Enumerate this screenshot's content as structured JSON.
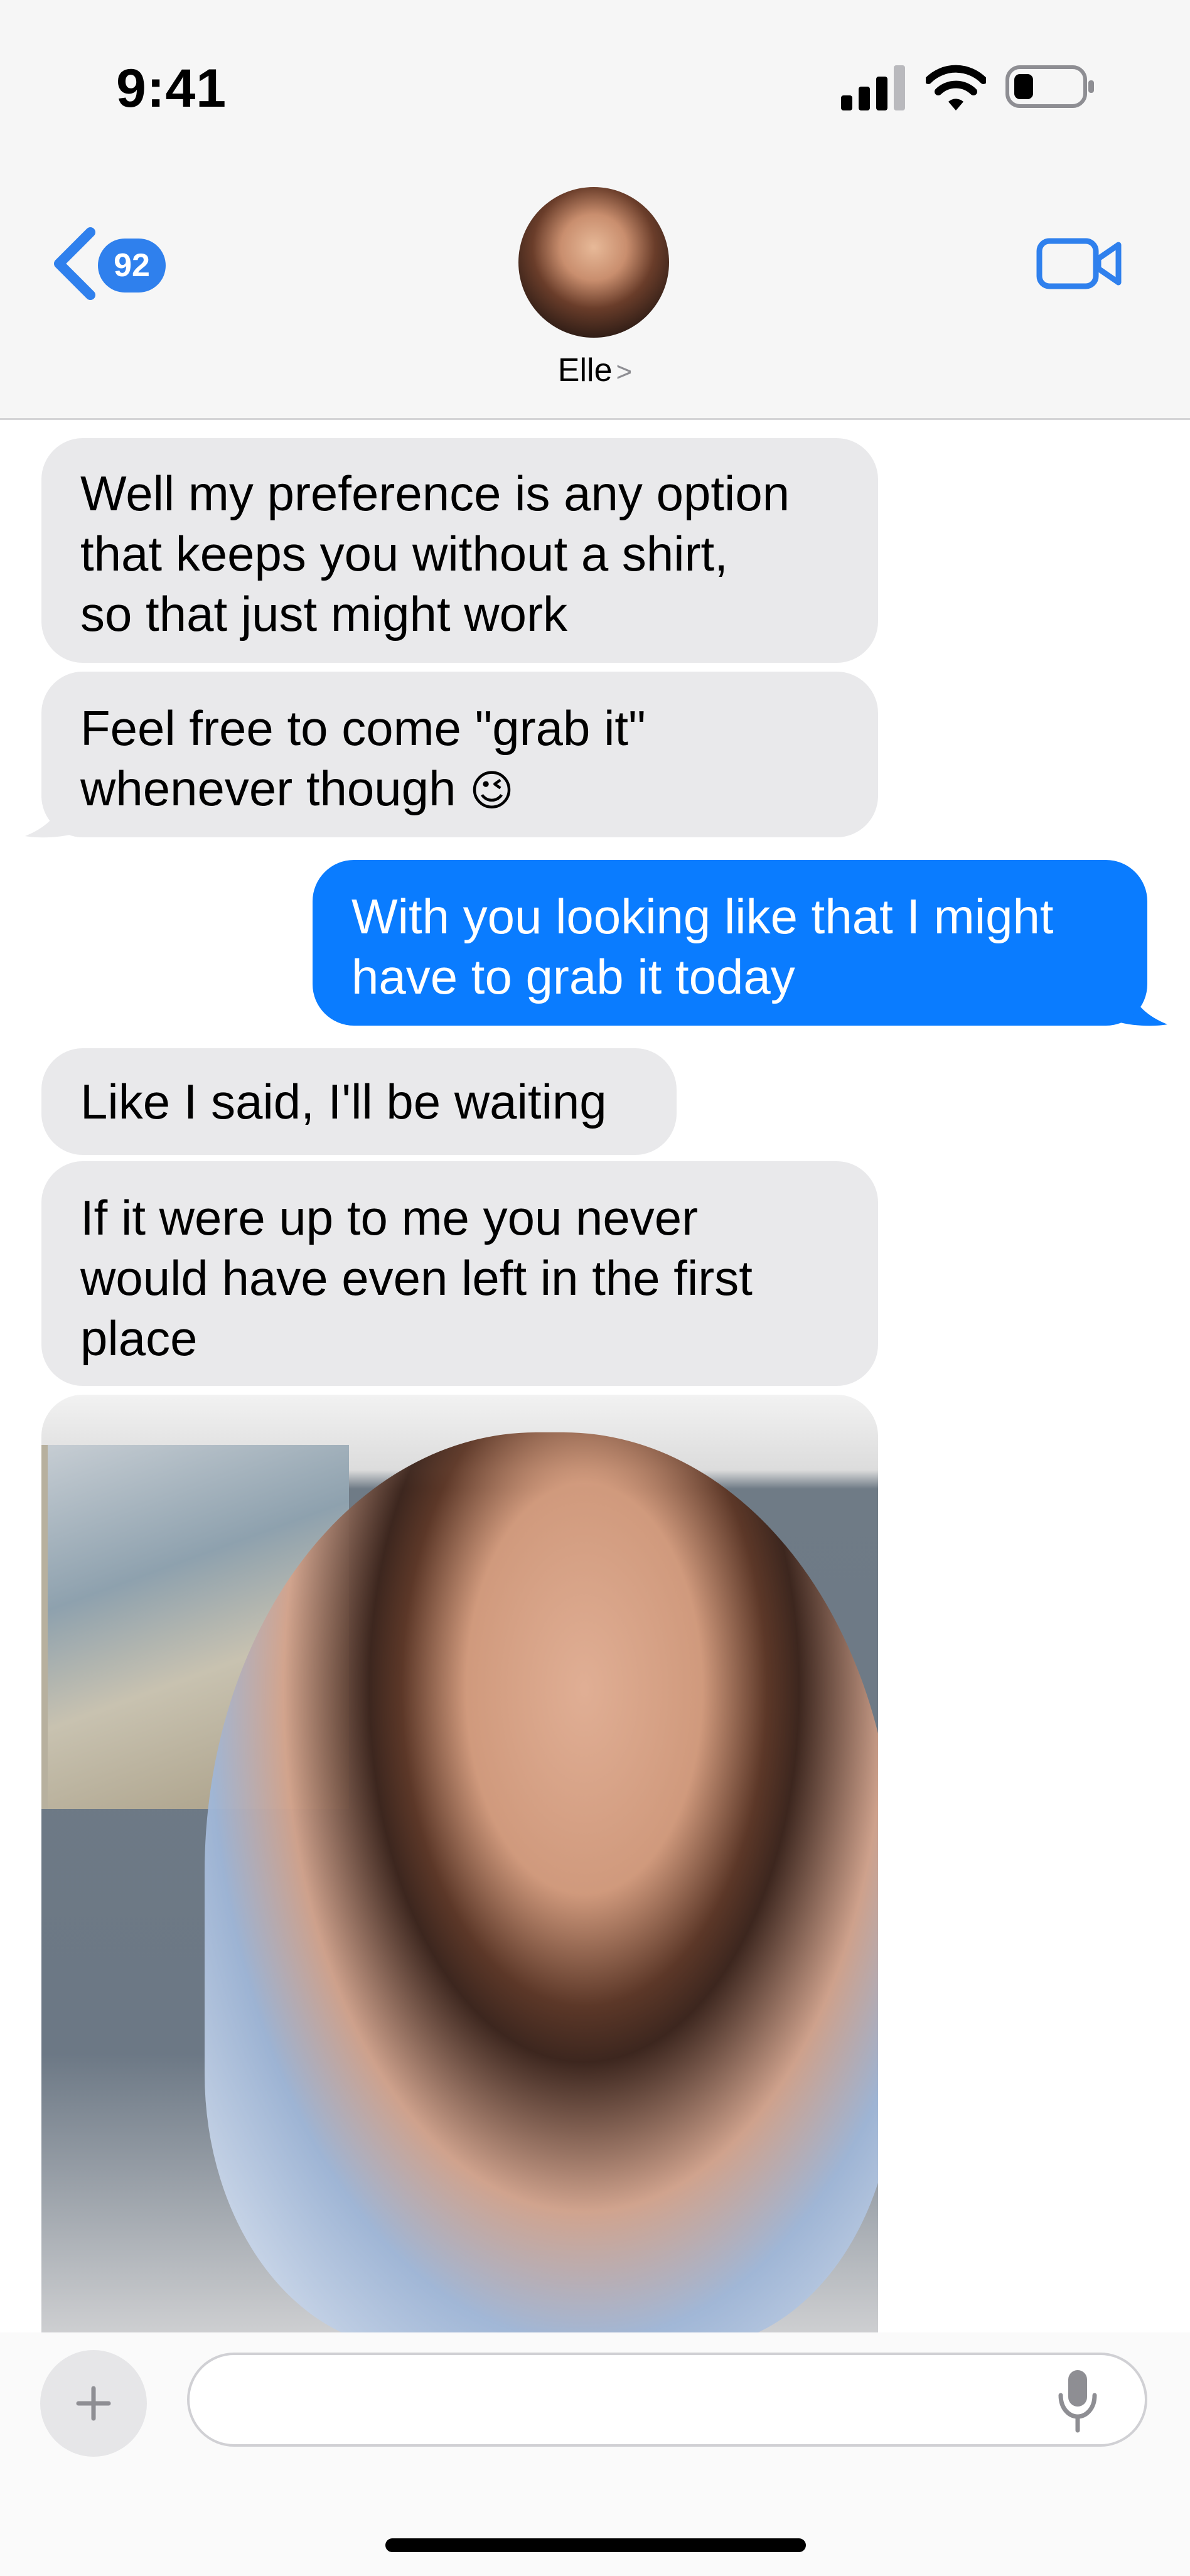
{
  "status_bar": {
    "time": "9:41",
    "icons": [
      "cellular-signal-icon",
      "wifi-icon",
      "battery-icon"
    ]
  },
  "header": {
    "back_badge_count": "92",
    "contact_name": "Elle",
    "contact_chevron": ">",
    "icons": [
      "back-chevron-icon",
      "video-call-icon",
      "avatar"
    ]
  },
  "messages": [
    {
      "direction": "incoming",
      "lines": [
        "Well my preference is any option",
        "that keeps you without a shirt,",
        "so that just might work"
      ]
    },
    {
      "direction": "incoming",
      "lines": [
        "Feel free to come \"grab it\"",
        "whenever though"
      ],
      "emoji": "😉"
    },
    {
      "direction": "outgoing",
      "lines": [
        "With you looking like that I might",
        "have to grab it today"
      ]
    },
    {
      "direction": "incoming",
      "lines": [
        "Like I said, I'll be waiting"
      ]
    },
    {
      "direction": "incoming",
      "lines": [
        "If it were up to me you never",
        "would have even left in the first",
        "place"
      ]
    },
    {
      "direction": "incoming",
      "type": "photo"
    }
  ],
  "composer": {
    "placeholder": "",
    "icons": [
      "plus-icon",
      "microphone-icon"
    ]
  },
  "colors": {
    "incoming_bubble": "#e9e9eb",
    "outgoing_bubble": "#0a7cff",
    "accent": "#2f80ed"
  }
}
